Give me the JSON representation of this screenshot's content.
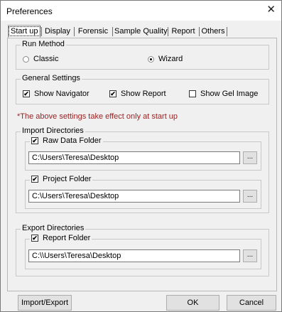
{
  "window": {
    "title": "Preferences"
  },
  "tabs": [
    "Start up",
    "Display",
    "Forensic",
    "Sample Quality",
    "Report",
    "Others"
  ],
  "run_method": {
    "legend": "Run Method",
    "options": [
      "Classic",
      "Wizard"
    ],
    "selected": "Wizard"
  },
  "general": {
    "legend": "General Settings",
    "show_navigator": "Show Navigator",
    "show_report": "Show Report",
    "show_gel": "Show Gel Image",
    "checked": [
      true,
      true,
      false
    ]
  },
  "note": "*The above settings take effect only at start up",
  "import": {
    "legend": "Import Directories",
    "raw_label": "Raw Data Folder",
    "raw_path": "C:\\Users\\Teresa\\Desktop",
    "project_label": "Project Folder",
    "project_path": "C:\\Users\\Teresa\\Desktop",
    "browse": "..."
  },
  "export": {
    "legend": "Export Directories",
    "report_label": "Report Folder",
    "report_path": "C:\\\\Users\\Teresa\\Desktop",
    "browse": "..."
  },
  "buttons": {
    "import_export": "Import/Export",
    "ok": "OK",
    "cancel": "Cancel"
  },
  "check_mark": "✔"
}
